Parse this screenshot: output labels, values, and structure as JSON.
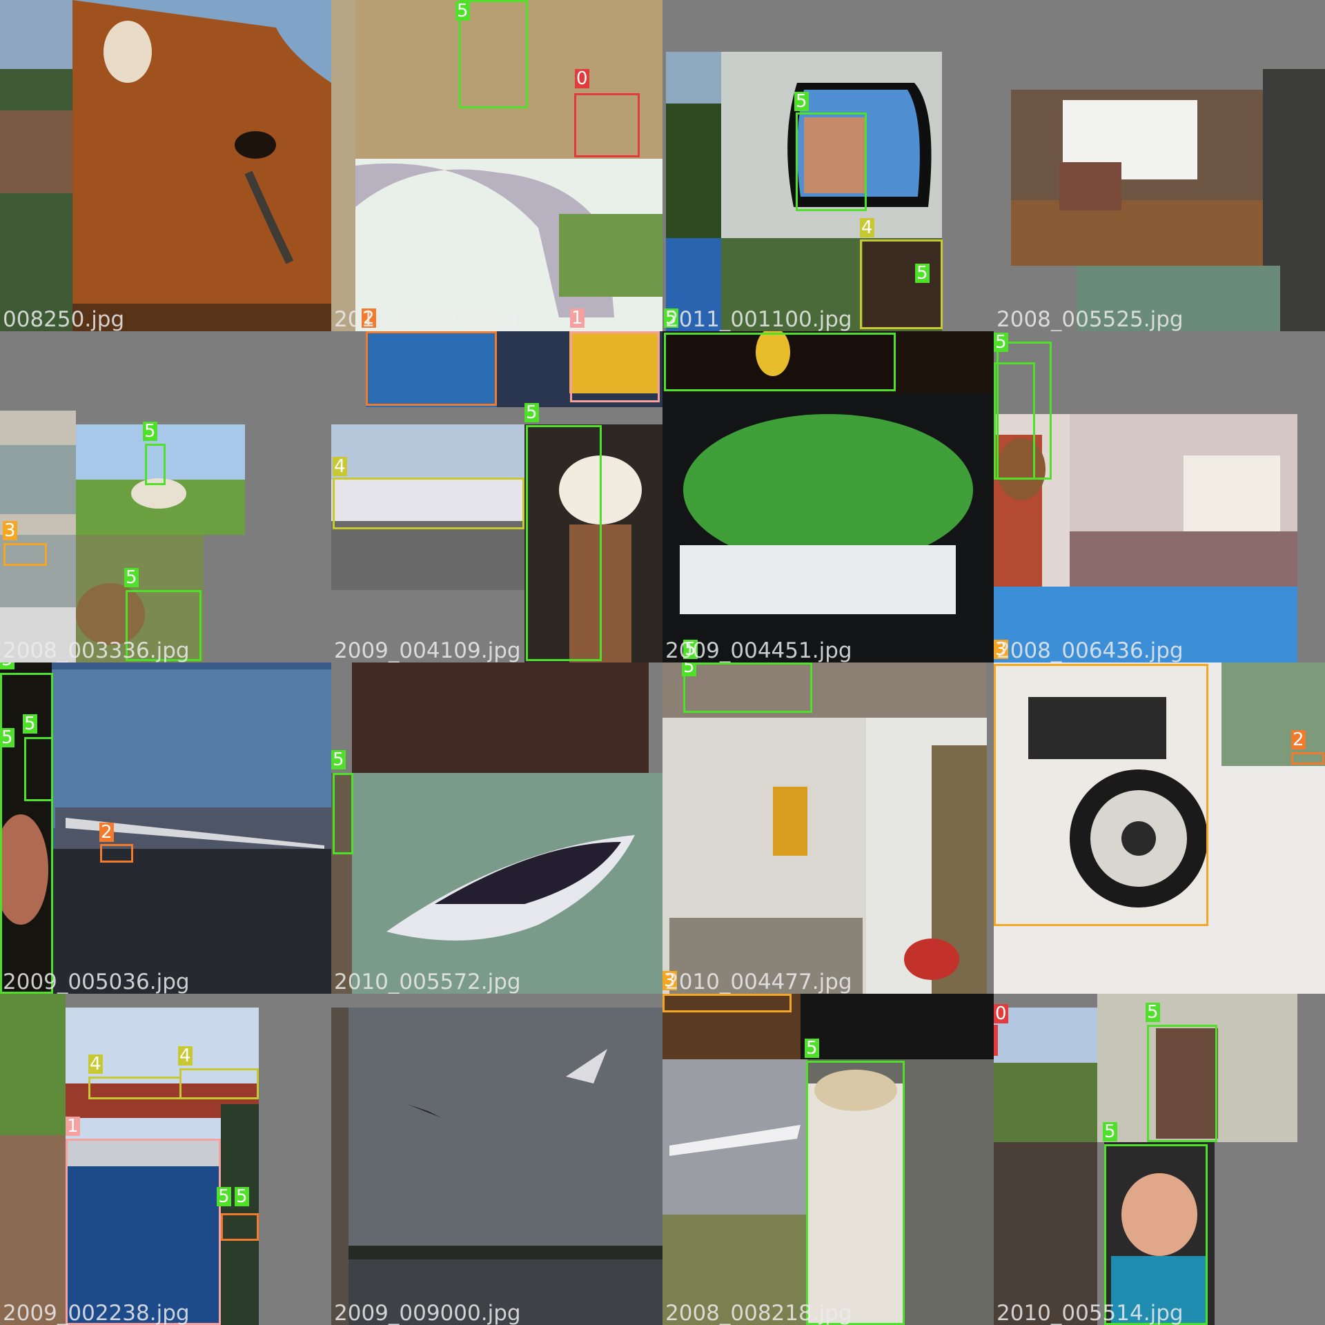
{
  "mosaic": {
    "tiles": [
      {
        "filename": "008250.jpg",
        "labels": []
      },
      {
        "filename": "2010_005369.jpg",
        "labels": [
          "5",
          "0",
          "2",
          "1"
        ]
      },
      {
        "filename": "2011_001100.jpg",
        "labels": [
          "5",
          "4",
          "5",
          "5"
        ]
      },
      {
        "filename": "2008_005525.jpg",
        "labels": []
      },
      {
        "filename": "2008_003336.jpg",
        "labels": [
          "5",
          "3",
          "5"
        ]
      },
      {
        "filename": "2009_004109.jpg",
        "labels": [
          "4",
          "5"
        ]
      },
      {
        "filename": "2009_004451.jpg",
        "labels": [
          "5"
        ]
      },
      {
        "filename": "2008_006436.jpg",
        "labels": [
          "5",
          "3"
        ]
      },
      {
        "filename": "2009_005036.jpg",
        "labels": [
          "5",
          "5",
          "5",
          "2"
        ]
      },
      {
        "filename": "2010_005572.jpg",
        "labels": [
          "5"
        ]
      },
      {
        "filename": "2010_004477.jpg",
        "labels": [
          "5",
          "3"
        ]
      },
      {
        "filename": "2011_001498.jpg",
        "labels": [
          "2"
        ]
      },
      {
        "filename": "2009_002238.jpg",
        "labels": [
          "4",
          "4",
          "1",
          "5",
          "5"
        ]
      },
      {
        "filename": "2009_009000.jpg",
        "labels": []
      },
      {
        "filename": "2008_008218.jpg",
        "labels": [
          "5"
        ]
      },
      {
        "filename": "2010_005514.jpg",
        "labels": [
          "0",
          "5",
          "5"
        ]
      }
    ]
  },
  "colors": {
    "class_0": "#e33b3b",
    "class_1": "#f6a0a0",
    "class_2": "#f27a2c",
    "class_3": "#f5a623",
    "class_4": "#c8c832",
    "class_5": "#4fe02a",
    "background": "#7d7d7d"
  }
}
